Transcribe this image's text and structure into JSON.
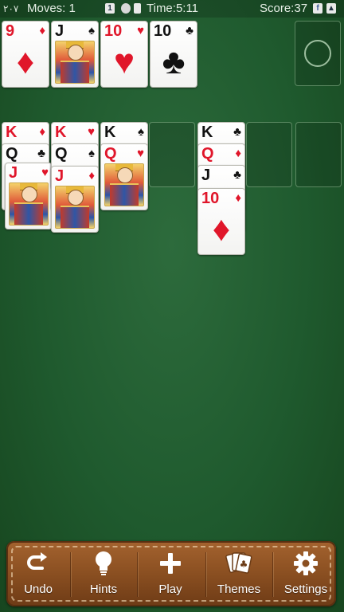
{
  "status_bar": {
    "system_text": "٢٠٧",
    "moves_label": "Moves: 1",
    "time_label": "Time:5:11",
    "score_label": "Score:37",
    "mini_box": "1",
    "icons": [
      "notification-icon",
      "alarm-icon",
      "battery-icon",
      "facebook-icon",
      "gallery-icon"
    ]
  },
  "foundation": [
    {
      "rank": "9",
      "suit": "♦",
      "color": "red",
      "type": "pip"
    },
    {
      "rank": "J",
      "suit": "♠",
      "color": "black",
      "type": "face"
    },
    {
      "rank": "10",
      "suit": "♥",
      "color": "red",
      "type": "pip"
    },
    {
      "rank": "10",
      "suit": "♣",
      "color": "black",
      "type": "pip"
    }
  ],
  "stock": {
    "icon": "recycle-ring-icon"
  },
  "tableau": [
    [
      {
        "rank": "K",
        "suit": "♦",
        "color": "red"
      },
      {
        "rank": "Q",
        "suit": "♣",
        "color": "black"
      },
      {
        "rank": "J",
        "suit": "♥",
        "color": "red",
        "type": "face"
      }
    ],
    [
      {
        "rank": "K",
        "suit": "♥",
        "color": "red"
      },
      {
        "rank": "Q",
        "suit": "♠",
        "color": "black"
      },
      {
        "rank": "J",
        "suit": "♦",
        "color": "red",
        "type": "face"
      }
    ],
    [
      {
        "rank": "K",
        "suit": "♠",
        "color": "black"
      },
      {
        "rank": "Q",
        "suit": "♥",
        "color": "red",
        "type": "face"
      }
    ],
    [],
    [
      {
        "rank": "K",
        "suit": "♣",
        "color": "black"
      },
      {
        "rank": "Q",
        "suit": "♦",
        "color": "red"
      },
      {
        "rank": "J",
        "suit": "♣",
        "color": "black"
      },
      {
        "rank": "10",
        "suit": "♦",
        "color": "red",
        "type": "pip"
      }
    ],
    [],
    []
  ],
  "toolbar": {
    "undo_label": "Undo",
    "hints_label": "Hints",
    "play_label": "Play",
    "themes_label": "Themes",
    "settings_label": "Settings"
  },
  "colors": {
    "felt": "#1f5a2e",
    "card_red": "#e0162a",
    "card_black": "#111111",
    "toolbar_wood": "#8a4f21"
  }
}
